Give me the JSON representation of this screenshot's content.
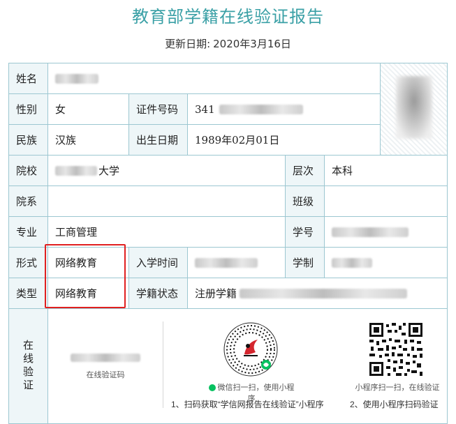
{
  "header": {
    "title": "教育部学籍在线验证报告",
    "update_label": "更新日期:",
    "update_date": "2020年3月16日"
  },
  "fields": {
    "name_label": "姓名",
    "gender_label": "性别",
    "gender_value": "女",
    "id_label": "证件号码",
    "id_value_prefix": "341",
    "ethnicity_label": "民族",
    "ethnicity_value": "汉族",
    "birth_label": "出生日期",
    "birth_value": "1989年02月01日",
    "school_label": "院校",
    "school_value_suffix": "大学",
    "level_label": "层次",
    "level_value": "本科",
    "dept_label": "院系",
    "class_label": "班级",
    "major_label": "专业",
    "major_value": "工商管理",
    "student_no_label": "学号",
    "form_label": "形式",
    "form_value": "网络教育",
    "enroll_label": "入学时间",
    "duration_label": "学制",
    "type_label": "类型",
    "type_value": "网络教育",
    "status_label": "学籍状态",
    "status_value": "注册学籍"
  },
  "verify": {
    "label": "在线验证",
    "code_caption": "在线验证码",
    "wechat_caption": "微信扫一扫，使用小程序",
    "mini_caption": "小程序扫一扫，在线验证",
    "step1": "1、扫码获取“学信网报告在线验证”小程序",
    "step2": "2、使用小程序扫码验证"
  },
  "icons": {
    "wechat": "wechat-mini-program-icon",
    "miniprogram": "mini-program-code-icon",
    "qrcode": "qr-code-icon"
  },
  "colors": {
    "title": "#3aa0a6",
    "border": "#9cc7d1",
    "label_bg": "#eef6f8",
    "highlight": "#e02020"
  }
}
